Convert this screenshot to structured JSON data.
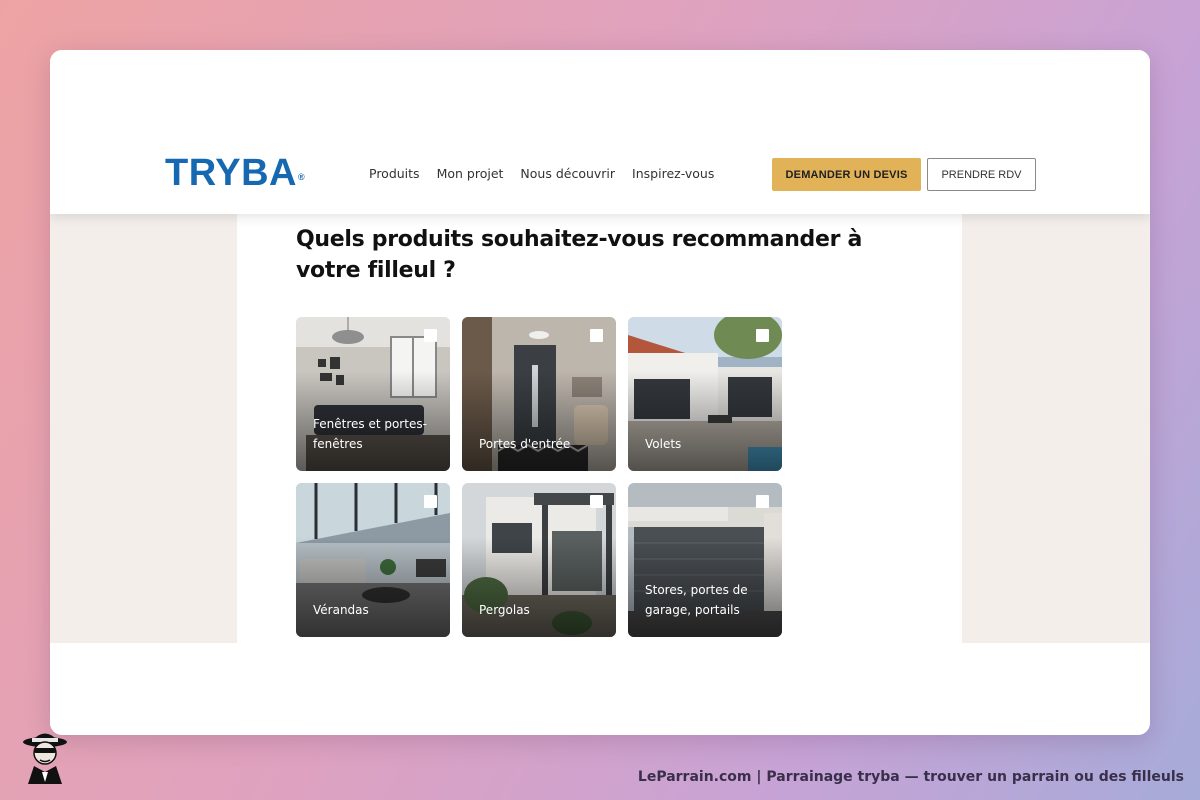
{
  "brand": {
    "logo_text": "TRYBA",
    "logo_mark": "®",
    "color": "#1668b0"
  },
  "nav": {
    "items": [
      {
        "label": "Produits"
      },
      {
        "label": "Mon projet"
      },
      {
        "label": "Nous découvrir"
      },
      {
        "label": "Inspirez-vous"
      }
    ]
  },
  "header": {
    "cta_primary": "DEMANDER UN DEVIS",
    "cta_secondary": "PRENDRE RDV",
    "accent_color": "#e2b258"
  },
  "main": {
    "question": "Quels produits souhaitez-vous recommander à votre filleul ?",
    "products": [
      {
        "label": "Fenêtres et portes-fenêtres",
        "checked": false,
        "icon": "living-room-photo"
      },
      {
        "label": "Portes d'entrée",
        "checked": false,
        "icon": "entry-door-photo"
      },
      {
        "label": "Volets",
        "checked": false,
        "icon": "shutters-photo"
      },
      {
        "label": "Vérandas",
        "checked": false,
        "icon": "veranda-photo"
      },
      {
        "label": "Pergolas",
        "checked": false,
        "icon": "pergola-photo"
      },
      {
        "label": "Stores, portes de garage, portails",
        "checked": false,
        "icon": "garage-door-photo"
      }
    ]
  },
  "footer": {
    "caption": "LeParrain.com | Parrainage tryba — trouver un parrain ou des filleuls",
    "mascot_icon": "spy-mascot-icon"
  }
}
